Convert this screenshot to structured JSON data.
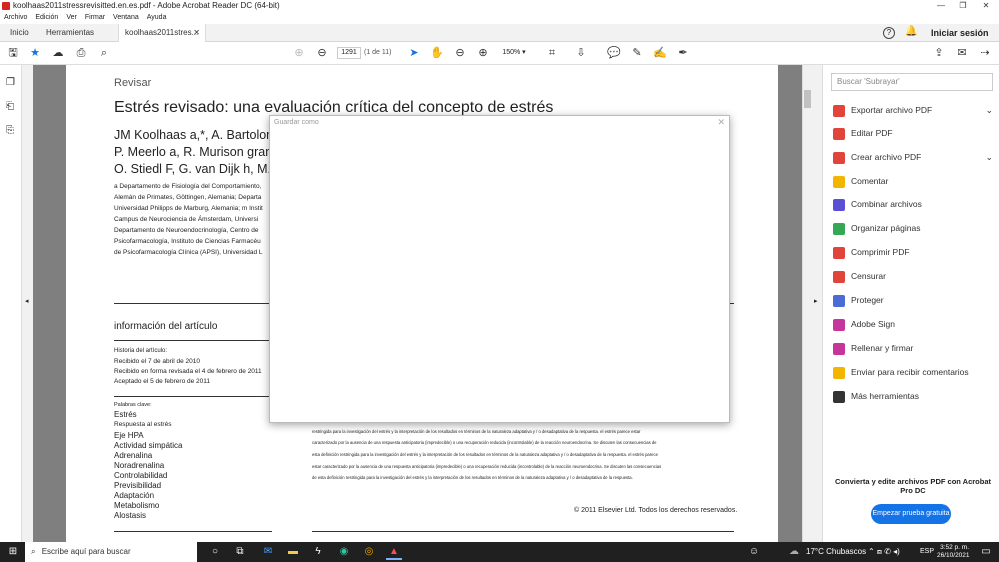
{
  "window": {
    "title": "koolhaas2011stressrevisitted.en.es.pdf - Adobe Acrobat Reader DC (64-bit)",
    "minimize": "—",
    "restore": "❐",
    "close": "✕"
  },
  "menu": [
    "Archivo",
    "Edición",
    "Ver",
    "Firmar",
    "Ventana",
    "Ayuda"
  ],
  "tabs": {
    "home": "Inicio",
    "tools": "Herramientas",
    "doc": "koolhaas2011stres...",
    "doc_close": "✕",
    "signin": "Iniciar sesión"
  },
  "toolbar": {
    "page": "1291",
    "page_count": "(1 de 11)",
    "zoom": "150%"
  },
  "page": {
    "section": "Revisar",
    "title": "Estrés revisado: una evaluación crítica del concepto de estrés",
    "authors": [
      "JM Koolhaas a,*, A. Bartolom",
      "P. Meerlo a, R. Murison gramo,",
      "O. Stiedl F, G. van Dijk h, M. V"
    ],
    "affil": [
      "a Departamento de Fisiología del Comportamiento,",
      "Alemán de Primates, Göttingen, Alemania; Departa",
      "Universidad Philipps de Marburg, Alemania; m Instit",
      "Campus de Neurociencia de Ámsterdam, Universi",
      "Departamento de Neuroendocrinología, Centro de",
      "Psicofarmacología, Instituto de Ciencias Farmacéu",
      "de Psicofarmacología Clínica (APSI), Universidad L"
    ],
    "info_heading": "información del artículo",
    "history": [
      "Historia del artículo:",
      "Recibido el 7 de abril de 2010",
      "Recibido en forma revisada el 4 de febrero de 2011",
      "Aceptado el 5 de febrero de 2011"
    ],
    "keywords_label": "Palabras clave:",
    "keywords": [
      "Estrés",
      "Respuesta al estrés",
      "Eje HPA",
      "Actividad simpática",
      "Adrenalina",
      "Noradrenalina",
      "Controlabilidad",
      "Previsibilidad",
      "Adaptación",
      "Metabolismo",
      "Alostasis"
    ],
    "abstract": [
      "restringida para la investigación del estrés y la interpretación de los resultados en términos de la naturaleza adaptativa y / o desadaptativa de la respuesta. el estrés parece estar",
      "caracterizado por la ausencia de una respuesta anticipatoria (impredecible) o una recuperación reducida (incontrolable) de la reacción neuroendocrina. Se discuten las consecuencias de",
      "esta definición restringida para la investigación del estrés y la interpretación de los resultados en términos de la naturaleza adaptativa y / o desadaptativa de la respuesta. el estrés parece",
      "estar caracterizado por la ausencia de una respuesta anticipatoria (impredecible) o una recuperación reducida (incontrolable) de la reacción neuroendocrina. Se discuten las consecuencias",
      "de esta definición restringida para la investigación del estrés y la interpretación de los resultados en términos de la naturaleza adaptativa y / o desadaptativa de la respuesta."
    ],
    "copyright": "© 2011 Elsevier Ltd. Todos los derechos reservados."
  },
  "dialog": {
    "title": "Guardar como",
    "close": "✕"
  },
  "right": {
    "search_placeholder": "Buscar 'Subrayar'",
    "items": [
      {
        "label": "Exportar archivo PDF",
        "color": "#e0443a"
      },
      {
        "label": "Editar PDF",
        "color": "#e0443a"
      },
      {
        "label": "Crear archivo PDF",
        "color": "#e0443a"
      },
      {
        "label": "Comentar",
        "color": "#f2b600"
      },
      {
        "label": "Combinar archivos",
        "color": "#5b4fd6"
      },
      {
        "label": "Organizar páginas",
        "color": "#35a853"
      },
      {
        "label": "Comprimir PDF",
        "color": "#e0443a"
      },
      {
        "label": "Censurar",
        "color": "#e0443a"
      },
      {
        "label": "Proteger",
        "color": "#4a6cd4"
      },
      {
        "label": "Adobe Sign",
        "color": "#c6359b"
      },
      {
        "label": "Rellenar y firmar",
        "color": "#c6359b"
      },
      {
        "label": "Enviar para recibir comentarios",
        "color": "#f2b600"
      },
      {
        "label": "Más herramientas",
        "color": "#333333"
      }
    ],
    "promo": "Convierta y edite archivos PDF con Acrobat Pro DC",
    "promo_button": "Empezar prueba gratuita"
  },
  "taskbar": {
    "search": "Escribe aquí para buscar",
    "weather": "17°C  Chubascos",
    "lang": "ESP",
    "time": "3:52 p. m.",
    "date": "26/10/2021"
  }
}
